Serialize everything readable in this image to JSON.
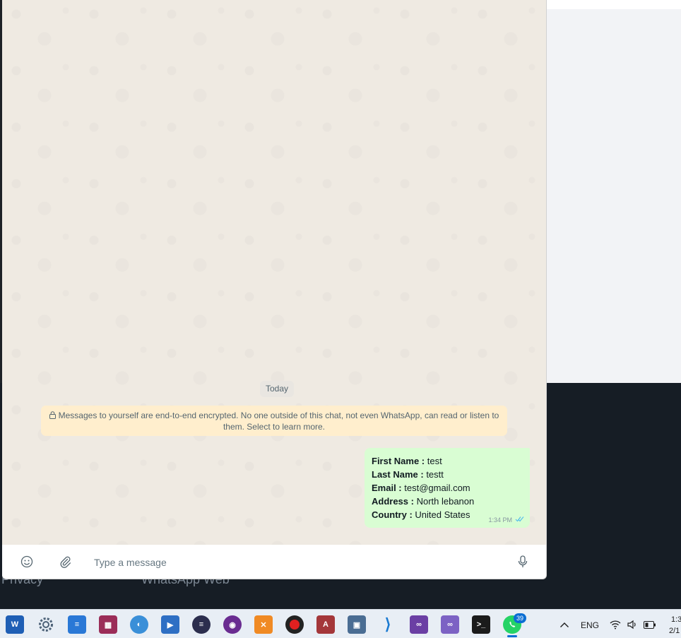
{
  "chat": {
    "date_chip": "Today",
    "encryption_notice": "Messages to yourself are end-to-end encrypted. No one outside of this chat, not even WhatsApp, can read or listen to them. Select to learn more.",
    "message": {
      "lines": [
        {
          "label": "First Name :",
          "value": " test"
        },
        {
          "label": "Last Name :",
          "value": " testt"
        },
        {
          "label": "Email :",
          "value": " test@gmail.com"
        },
        {
          "label": "Address :",
          "value": " North lebanon"
        },
        {
          "label": "Country :",
          "value": " United States"
        }
      ],
      "time": "1:34 PM",
      "status_icon": "double-check-icon"
    }
  },
  "composer": {
    "placeholder": "Type a message",
    "icons": [
      "emoji-icon",
      "attach-icon",
      "mic-icon"
    ]
  },
  "background_page": {
    "footer_links": [
      "Privacy",
      "WhatsApp Web"
    ]
  },
  "taskbar": {
    "apps": [
      "word",
      "settings",
      "notepad",
      "winrar",
      "browser",
      "media-player",
      "eclipse",
      "tor-browser",
      "xampp",
      "obs",
      "access",
      "rdp",
      "vscode",
      "visual-studio",
      "visual-studio-preview",
      "terminal",
      "whatsapp"
    ],
    "whatsapp_badge": "39",
    "language": "ENG",
    "clock_time": "1:3",
    "clock_date": "2/1"
  },
  "colors": {
    "bubble_out": "#d9fdd3",
    "chat_bg": "#efeae2",
    "notice_bg": "#ffeecd",
    "read_ticks": "#53bdeb",
    "taskbar_accent": "#0b6ed3"
  }
}
